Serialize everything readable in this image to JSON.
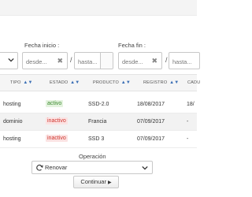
{
  "filters": {
    "start_label": "Fecha inicio :",
    "end_label": "Fecha fin :",
    "from_placeholder": "desde...",
    "to_placeholder": "hasta...",
    "clear_glyph": "✖",
    "separator": "/"
  },
  "table": {
    "headers": [
      "TIPO",
      "ESTADO",
      "PRODUCTO",
      "REGISTRO",
      "CADU"
    ],
    "sort_glyph": "▲▼",
    "rows": [
      {
        "tipo": "hosting",
        "estado": "activo",
        "estado_status": "active",
        "producto": "SSD-2.0",
        "registro": "18/08/2017",
        "caducidad": "18/"
      },
      {
        "tipo": "dominio",
        "estado": "inactivo",
        "estado_status": "inactive",
        "producto": "Francia",
        "registro": "07/09/2017",
        "caducidad": "-"
      },
      {
        "tipo": "hosting",
        "estado": "inactivo",
        "estado_status": "inactive",
        "producto": "SSD 3",
        "registro": "07/09/2017",
        "caducidad": "-"
      }
    ]
  },
  "operation": {
    "label": "Operación",
    "selected": "Renovar",
    "icon": "refresh-icon"
  },
  "continue_button": {
    "label": "Continuar",
    "icon": "play-icon",
    "glyph": "▶"
  },
  "colors": {
    "sort_arrow": "#3b6fb5",
    "active_bg": "#e4f3df",
    "active_text": "#3c8a2e",
    "inactive_bg": "#fbe3e3",
    "inactive_text": "#d0342c"
  }
}
